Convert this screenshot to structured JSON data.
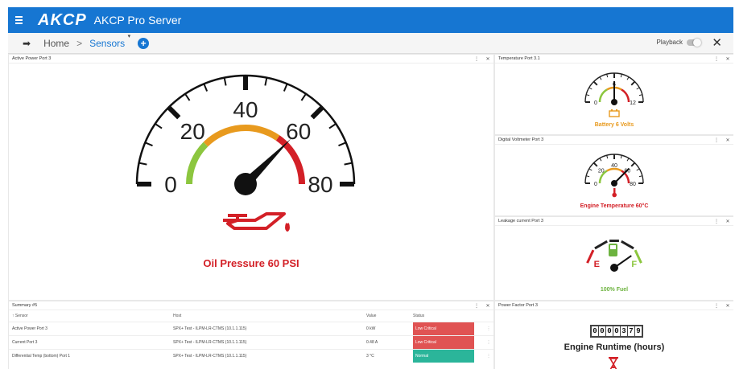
{
  "app": {
    "logo": "AKCP",
    "title": "AKCP Pro Server"
  },
  "toolbar": {
    "home": "Home",
    "sep": ">",
    "sensors": "Sensors",
    "playback": "Playback"
  },
  "colors": {
    "brand": "#1676d2",
    "critical": "#d32027",
    "warning": "#e89a1e",
    "ok": "#8cc63f",
    "fuel": "#6db33f",
    "low_critical_bg": "#e05353",
    "normal_bg": "#2bb59a"
  },
  "main_gauge": {
    "title": "Active Power Port 3",
    "caption": "Oil Pressure 60 PSI",
    "icon": "oil-can-icon",
    "value": 60,
    "min": 0,
    "max": 80,
    "major_ticks": [
      "0",
      "20",
      "40",
      "60",
      "80"
    ]
  },
  "small_gauges": [
    {
      "title": "Temperature Port 3.1",
      "caption": "Battery 6 Volts",
      "icon": "battery-icon",
      "caption_color": "#e89a1e",
      "ticks": [
        "0",
        "6",
        "12"
      ],
      "value": 6,
      "min": 0,
      "max": 12
    },
    {
      "title": "Digital Voltmeter Port 3",
      "caption": "Engine Temperature 60°C",
      "icon": "thermometer-icon",
      "caption_color": "#d32027",
      "ticks": [
        "0",
        "20",
        "40",
        "60",
        "80"
      ],
      "value": 60,
      "min": 0,
      "max": 80
    },
    {
      "title": "Leakage current Port 3",
      "caption": "100% Fuel",
      "icon": "fuel-pump-icon",
      "caption_color": "#6db33f",
      "ticks": [
        "E",
        "F"
      ],
      "value": 100,
      "min": 0,
      "max": 100
    }
  ],
  "summary": {
    "title": "Summary #5",
    "columns": [
      "Sensor",
      "Host",
      "Value",
      "Status"
    ],
    "rows": [
      {
        "sensor": "Active Power Port 3",
        "host": "SPX+ Test - ILPM-LR-CTMS (10.1.1.115)",
        "value": "0 kW",
        "status": "Low Critical"
      },
      {
        "sensor": "Current Port 3",
        "host": "SPX+ Test - ILPM-LR-CTMS (10.1.1.115)",
        "value": "0.48 A",
        "status": "Low Critical"
      },
      {
        "sensor": "Differential Temp (bottom) Port 1",
        "host": "SPX+ Test - ILPM-LR-CTMS (10.1.1.115)",
        "value": "3 °C",
        "status": "Normal"
      }
    ]
  },
  "runtime": {
    "title": "Power Factor Port 3",
    "digits": "0000379",
    "caption": "Engine Runtime (hours)",
    "icon": "hourglass-icon"
  }
}
